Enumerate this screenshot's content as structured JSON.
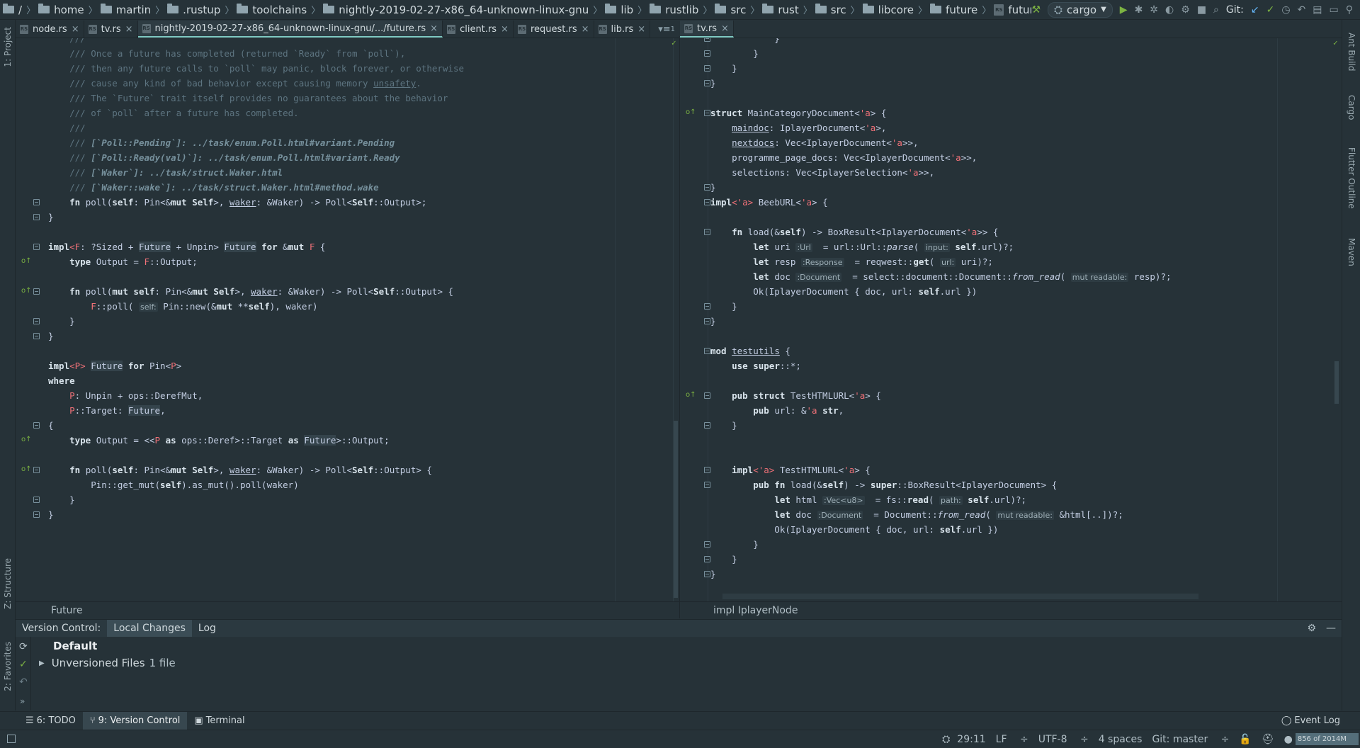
{
  "navbar": {
    "crumbs": [
      "/",
      "home",
      "martin",
      ".rustup",
      "toolchains",
      "nightly-2019-02-27-x86_64-unknown-linux-gnu",
      "lib",
      "rustlib",
      "src",
      "rust",
      "src",
      "libcore",
      "future"
    ],
    "file": "future.rs",
    "run_config": "cargo",
    "git_label": "Git:"
  },
  "left_tabs": [
    {
      "label": "node.rs"
    },
    {
      "label": "tv.rs"
    },
    {
      "label": "nightly-2019-02-27-x86_64-unknown-linux-gnu/.../future.rs"
    },
    {
      "label": "client.rs"
    },
    {
      "label": "request.rs"
    },
    {
      "label": "lib.rs"
    }
  ],
  "left_tab_overflow": "1",
  "right_tabs": [
    {
      "label": "tv.rs"
    }
  ],
  "left_sidebar": {
    "project": "1: Project",
    "structure": "Z: Structure",
    "favorites": "2: Favorites"
  },
  "right_sidebar": {
    "ant": "Ant Build",
    "cargo": "Cargo",
    "flutter": "Flutter Outline",
    "maven": "Maven"
  },
  "left_breadcrumb": "Future",
  "right_breadcrumb": "impl IplayerNode",
  "version_control": {
    "title": "Version Control:",
    "tabs": [
      "Local Changes",
      "Log"
    ],
    "group": "Default",
    "unversioned_label": "Unversioned Files",
    "unversioned_count": "1 file"
  },
  "bottom_tools": {
    "todo": "6: TODO",
    "vc": "9: Version Control",
    "terminal": "Terminal",
    "event_log": "Event Log"
  },
  "status": {
    "position": "29:11",
    "line_sep": "LF",
    "encoding": "UTF-8",
    "indent": "4 spaces",
    "branch": "Git: master",
    "memory": "856 of 2014M"
  },
  "colors": {
    "accent": "#80cbc4",
    "run": "#7cb342",
    "background": "#263238"
  }
}
